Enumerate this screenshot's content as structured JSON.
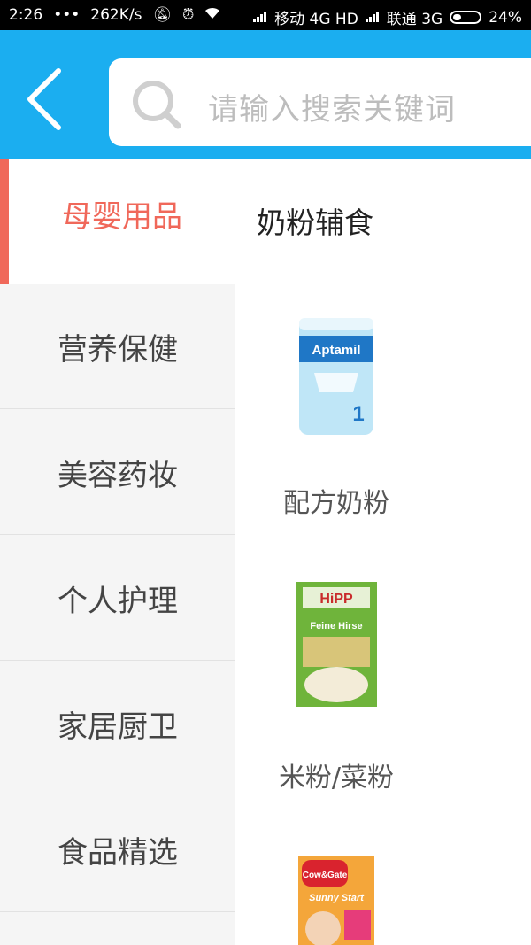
{
  "status_bar": {
    "time": "2:26",
    "dots": "•••",
    "speed": "262K/s",
    "carrier1": "移动 4G HD",
    "carrier2": "联通 3G",
    "battery": "24%"
  },
  "header": {
    "search_placeholder": "请输入搜索关键词"
  },
  "sidebar": {
    "items": [
      {
        "label": "母婴用品",
        "active": true
      },
      {
        "label": "营养保健"
      },
      {
        "label": "美容药妆"
      },
      {
        "label": "个人护理"
      },
      {
        "label": "家居厨卫"
      },
      {
        "label": "食品精选"
      }
    ]
  },
  "main": {
    "category_title": "奶粉辅食",
    "products": [
      {
        "label": "配方奶粉",
        "brand_text": "Aptamil",
        "badge": "1"
      },
      {
        "label": "米粉/菜粉",
        "brand_text": "HiPP",
        "sub_text": "Feine Hirse"
      },
      {
        "label": "",
        "brand_text": "Cow&Gate",
        "sub_text": "Sunny Start"
      }
    ]
  },
  "colors": {
    "header_blue": "#1baef0",
    "active_red": "#f0685a"
  }
}
